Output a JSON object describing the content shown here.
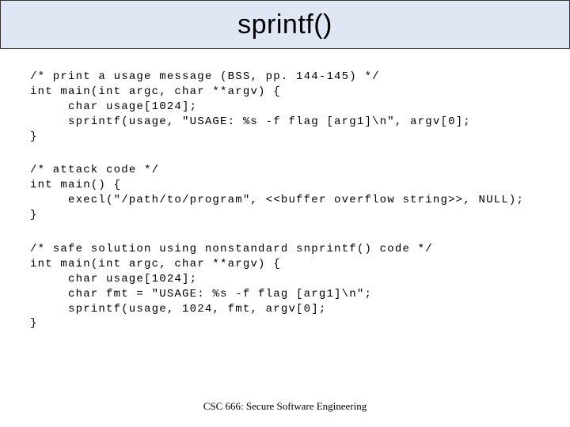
{
  "title": "sprintf()",
  "footer": "CSC 666: Secure Software Engineering",
  "code": {
    "block1": {
      "comment": "/* print a usage message (BSS, pp. 144-145) */",
      "line1": "int main(int argc, char **argv) {",
      "line2": "char usage[1024];",
      "line3": "sprintf(usage, \"USAGE: %s -f flag [arg1]\\n\", argv[0];",
      "close": "}"
    },
    "block2": {
      "comment": "/* attack code */",
      "line1": "int main() {",
      "line2": "execl(\"/path/to/program\", <<buffer overflow string>>, NULL);",
      "close": "}"
    },
    "block3": {
      "comment": "/* safe solution using nonstandard snprintf() code */",
      "line1": "int main(int argc, char **argv) {",
      "line2": "char usage[1024];",
      "line3": "char fmt = \"USAGE: %s -f flag [arg1]\\n\";",
      "line4": "sprintf(usage, 1024, fmt, argv[0];",
      "close": "}"
    }
  }
}
